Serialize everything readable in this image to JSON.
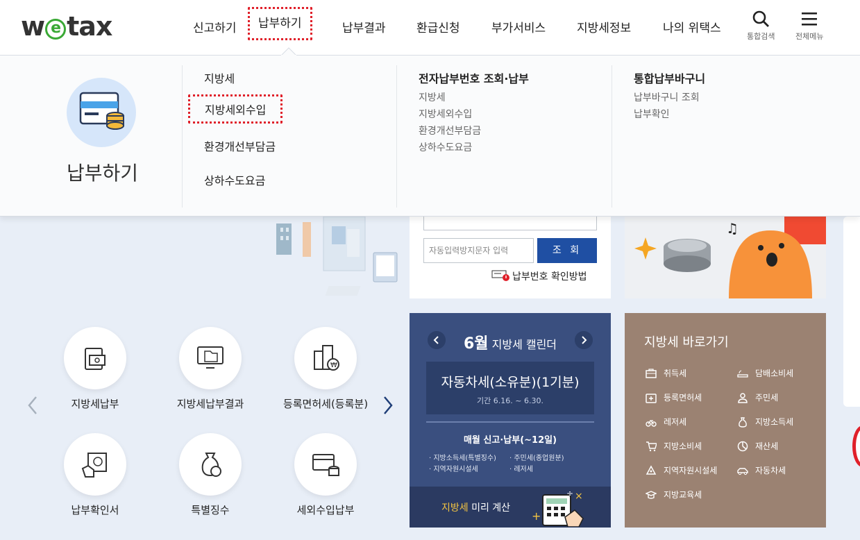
{
  "header": {
    "logo": {
      "pre": "w",
      "e": "e",
      "post": "tax"
    },
    "nav": [
      "신고하기",
      "납부하기",
      "납부결과",
      "환급신청",
      "부가서비스",
      "지방세정보",
      "나의 위택스"
    ],
    "search_label": "통합검색",
    "menu_label": "전체메뉴"
  },
  "mega_menu": {
    "title": "납부하기",
    "col1": [
      "지방세",
      "지방세외수입",
      "환경개선부담금",
      "상하수도요금"
    ],
    "col2": {
      "title": "전자납부번호 조회·납부",
      "items": [
        "지방세",
        "지방세외수입",
        "환경개선부담금",
        "상하수도요금"
      ]
    },
    "col3": {
      "title": "통합납부바구니",
      "items": [
        "납부바구니 조회",
        "납부확인"
      ]
    }
  },
  "search_panel": {
    "captcha_placeholder": "자동입력방지문자 입력",
    "search_button": "조 회",
    "howto": "납부번호 확인방법"
  },
  "quick_menu": [
    "지방세납부",
    "지방세납부결과",
    "등록면허세(등록분)",
    "납부확인서",
    "특별징수",
    "세외수입납부"
  ],
  "calendar": {
    "month": "6월",
    "title": "지방세 캘린더",
    "main_item": "자동차세(소유분)(1기분)",
    "period": "기간 6.16. ~ 6.30.",
    "monthly_title": "매월 신고·납부(~12일)",
    "monthly_items": [
      "지방소득세(특별징수)",
      "주민세(종업원분)",
      "지역자원시설세",
      "레저세"
    ],
    "bottom_highlight": "지방세",
    "bottom_text": " 미리 계산"
  },
  "shortcuts": {
    "title": "지방세 바로가기",
    "items": [
      "취득세",
      "담배소비세",
      "등록면허세",
      "주민세",
      "레저세",
      "지방소득세",
      "지방소비세",
      "재산세",
      "지역자원시설세",
      "자동차세",
      "지방교육세"
    ]
  }
}
